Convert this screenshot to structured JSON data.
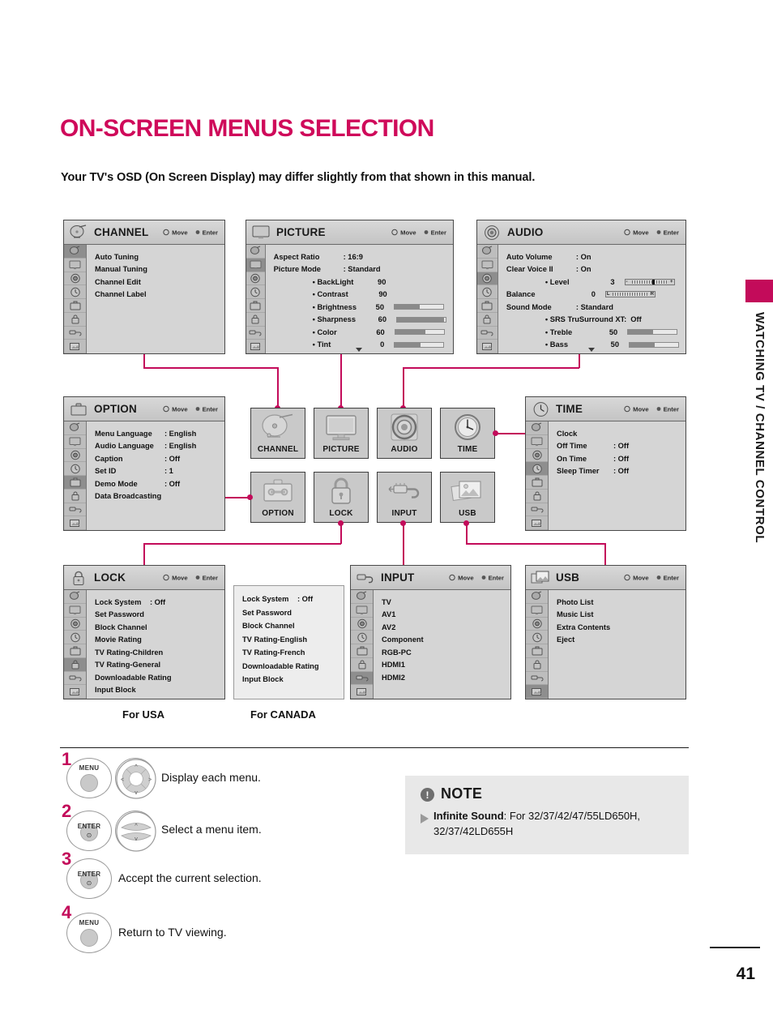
{
  "header": {
    "title": "ON-SCREEN MENUS SELECTION",
    "intro": "Your TV's OSD (On Screen Display) may differ slightly from that shown in this manual."
  },
  "hints": {
    "move": "Move",
    "enter": "Enter"
  },
  "menus": {
    "channel": {
      "title": "CHANNEL",
      "items": [
        {
          "label": "Auto Tuning",
          "value": ""
        },
        {
          "label": "Manual Tuning",
          "value": ""
        },
        {
          "label": "Channel Edit",
          "value": ""
        },
        {
          "label": "Channel Label",
          "value": ""
        }
      ]
    },
    "picture": {
      "title": "PICTURE",
      "items": [
        {
          "label": "Aspect Ratio",
          "value": ": 16:9"
        },
        {
          "label": "Picture Mode",
          "value": ": Standard"
        }
      ],
      "sub": [
        {
          "label": "• BackLight",
          "num": "90",
          "bar": 0
        },
        {
          "label": "• Contrast",
          "num": "90",
          "bar": 0
        },
        {
          "label": "• Brightness",
          "num": "50",
          "bar": 52
        },
        {
          "label": "• Sharpness",
          "num": "60",
          "bar": 96
        },
        {
          "label": "• Color",
          "num": "60",
          "bar": 62
        },
        {
          "label": "• Tint",
          "num": "0",
          "bar": 52
        }
      ]
    },
    "audio": {
      "title": "AUDIO",
      "items": [
        {
          "label": "Auto Volume",
          "value": ": On"
        },
        {
          "label": "Clear Voice II",
          "value": ": On"
        }
      ],
      "level": {
        "label": "• Level",
        "num": "3"
      },
      "balance": {
        "label": "Balance",
        "num": "0"
      },
      "sound_mode": {
        "label": "Sound Mode",
        "value": ": Standard"
      },
      "sub": [
        {
          "label": "• SRS TruSurround XT:",
          "num": "Off",
          "bar": -1
        },
        {
          "label": "• Treble",
          "num": "50",
          "bar": 52
        },
        {
          "label": "• Bass",
          "num": "50",
          "bar": 52
        }
      ]
    },
    "option": {
      "title": "OPTION",
      "items": [
        {
          "label": "Menu Language",
          "value": ": English"
        },
        {
          "label": "Audio Language",
          "value": ": English"
        },
        {
          "label": "Caption",
          "value": ": Off"
        },
        {
          "label": "Set ID",
          "value": ": 1"
        },
        {
          "label": "Demo Mode",
          "value": ": Off"
        },
        {
          "label": "Data Broadcasting",
          "value": ""
        }
      ]
    },
    "time": {
      "title": "TIME",
      "items": [
        {
          "label": "Clock",
          "value": ""
        },
        {
          "label": "Off Time",
          "value": ": Off"
        },
        {
          "label": "On Time",
          "value": ": Off"
        },
        {
          "label": "Sleep Timer",
          "value": ": Off"
        }
      ]
    },
    "lock": {
      "title": "LOCK",
      "items": [
        {
          "label": "Lock System",
          "value": ": Off"
        },
        {
          "label": "Set Password",
          "value": ""
        },
        {
          "label": "Block Channel",
          "value": ""
        },
        {
          "label": "Movie Rating",
          "value": ""
        },
        {
          "label": "TV Rating-Children",
          "value": ""
        },
        {
          "label": "TV Rating-General",
          "value": ""
        },
        {
          "label": "Downloadable Rating",
          "value": ""
        },
        {
          "label": "Input Block",
          "value": ""
        }
      ]
    },
    "lock_canada": {
      "items": [
        {
          "label": "Lock System",
          "value": ": Off"
        },
        {
          "label": "Set Password",
          "value": ""
        },
        {
          "label": "Block Channel",
          "value": ""
        },
        {
          "label": "TV Rating-English",
          "value": ""
        },
        {
          "label": "TV Rating-French",
          "value": ""
        },
        {
          "label": "Downloadable Rating",
          "value": ""
        },
        {
          "label": "Input Block",
          "value": ""
        }
      ]
    },
    "input": {
      "title": "INPUT",
      "items": [
        {
          "label": "TV",
          "value": ""
        },
        {
          "label": "AV1",
          "value": ""
        },
        {
          "label": "AV2",
          "value": ""
        },
        {
          "label": "Component",
          "value": ""
        },
        {
          "label": "RGB-PC",
          "value": ""
        },
        {
          "label": "HDMI1",
          "value": ""
        },
        {
          "label": "HDMI2",
          "value": ""
        }
      ]
    },
    "usb": {
      "title": "USB",
      "items": [
        {
          "label": "Photo List",
          "value": ""
        },
        {
          "label": "Music List",
          "value": ""
        },
        {
          "label": "Extra Contents",
          "value": ""
        },
        {
          "label": "Eject",
          "value": ""
        }
      ]
    }
  },
  "icon_buttons": [
    {
      "caption": "CHANNEL",
      "icon": "satellite-dish-icon"
    },
    {
      "caption": "PICTURE",
      "icon": "monitor-icon"
    },
    {
      "caption": "AUDIO",
      "icon": "speaker-icon"
    },
    {
      "caption": "TIME",
      "icon": "clock-icon"
    },
    {
      "caption": "OPTION",
      "icon": "toolbox-icon"
    },
    {
      "caption": "LOCK",
      "icon": "padlock-icon"
    },
    {
      "caption": "INPUT",
      "icon": "plug-icon"
    },
    {
      "caption": "USB",
      "icon": "photos-icon"
    }
  ],
  "captions": {
    "usa": "For USA",
    "canada": "For CANADA"
  },
  "steps": [
    {
      "num": "1",
      "button": "MENU",
      "text": "Display each menu.",
      "pad": "four-way"
    },
    {
      "num": "2",
      "button": "ENTER",
      "text": "Select a menu item.",
      "pad": "up-down"
    },
    {
      "num": "3",
      "button": "ENTER",
      "text": "Accept the current selection.",
      "pad": "none"
    },
    {
      "num": "4",
      "button": "MENU",
      "text": "Return to TV viewing.",
      "pad": "none"
    }
  ],
  "note": {
    "title": "NOTE",
    "badge": "!",
    "bold": "Infinite Sound",
    "rest": ": For 32/37/42/47/55LD650H, 32/37/42LD655H"
  },
  "sidebar": {
    "vertical_text": "WATCHING TV / CHANNEL CONTROL"
  },
  "footer": {
    "page_number": "41"
  },
  "colors": {
    "accent": "#c30b5a",
    "title": "#cf0a5a"
  }
}
